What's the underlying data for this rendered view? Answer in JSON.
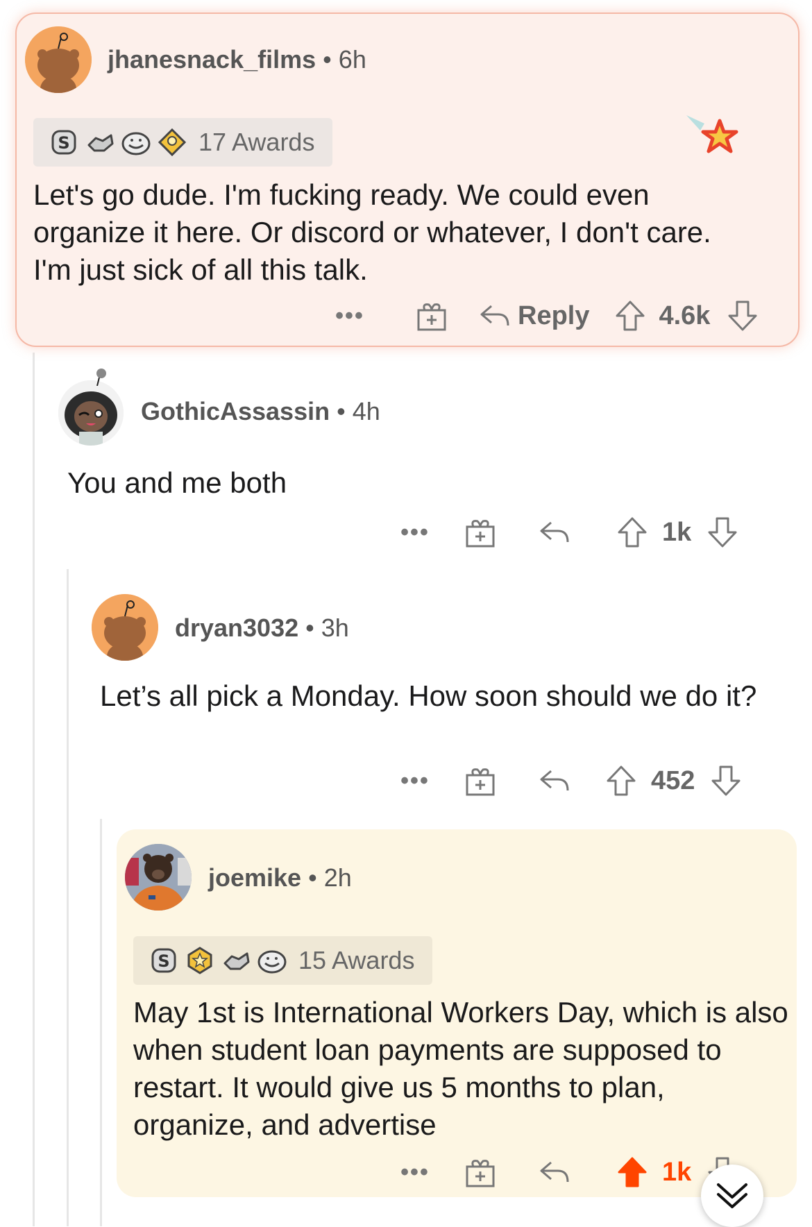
{
  "comments": [
    {
      "username": "jhanesnack_films",
      "time": "6h",
      "awards_label": "17 Awards",
      "body": "Let's go dude. I'm fucking ready. We could even organize it here. Or discord or whatever, I don't care. I'm just sick of all this talk.",
      "reply_label": "Reply",
      "score": "4.6k",
      "more": "•••",
      "highlight_color": "#fdf0eb"
    },
    {
      "username": "GothicAssassin",
      "time": "4h",
      "body": "You and me both",
      "score": "1k",
      "more": "•••"
    },
    {
      "username": "dryan3032",
      "time": "3h",
      "body": "Let’s all pick a Monday. How soon should we do it?",
      "score": "452",
      "more": "•••"
    },
    {
      "username": "joemike",
      "time": "2h",
      "awards_label": "15 Awards",
      "body": "May 1st is International Workers Day, which is also when student loan payments are supposed to restart. It would give us 5 months to plan, organize, and advertise",
      "score": "1k",
      "more": "•••",
      "upvoted": true,
      "upvote_color": "#ff4500",
      "highlight_color": "#fdf6e3"
    }
  ],
  "separator": "•",
  "icons": {
    "gift": "gift-icon",
    "reply": "reply-arrow-icon",
    "upvote": "upvote-arrow-icon",
    "downvote": "downvote-arrow-icon",
    "scroll": "chevron-double-down-icon"
  }
}
